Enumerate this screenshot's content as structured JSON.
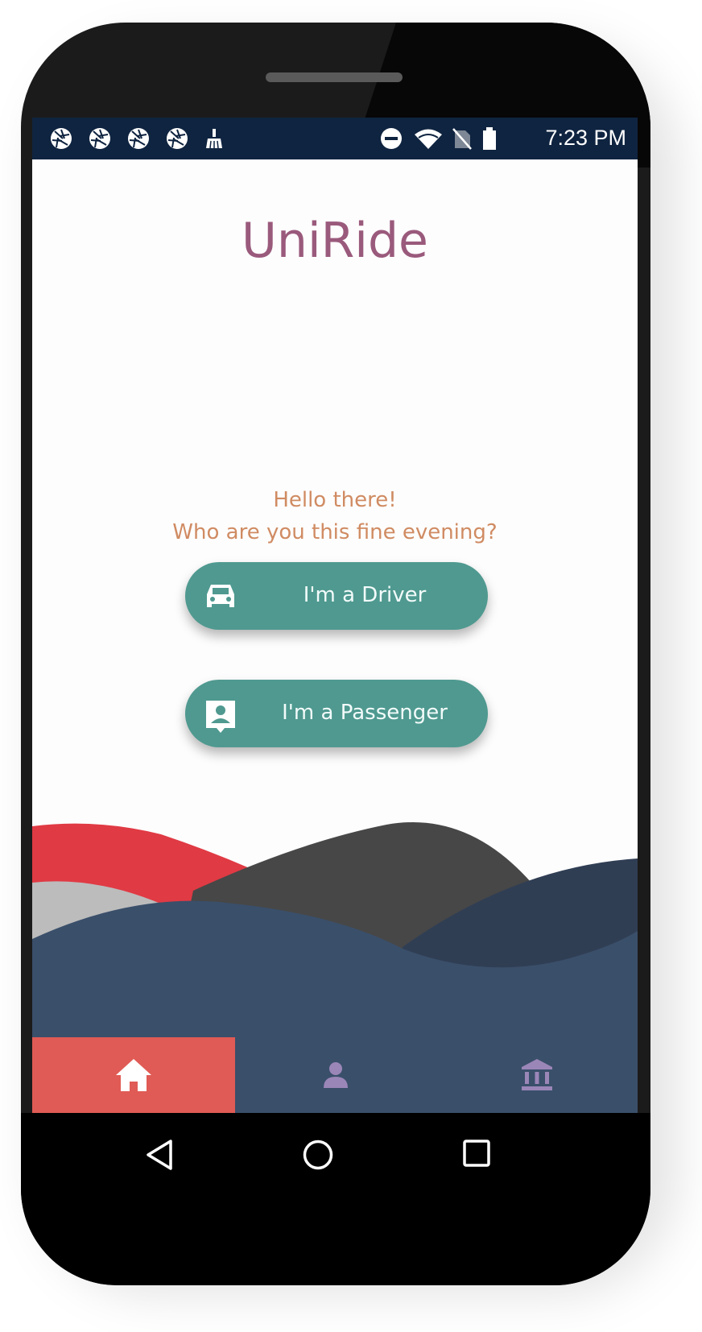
{
  "status_bar": {
    "time": "7:23 PM",
    "left_icons": [
      "aperture-icon",
      "aperture-icon",
      "aperture-icon",
      "aperture-icon",
      "broom-icon"
    ],
    "right_icons": [
      "do-not-disturb-icon",
      "wifi-icon",
      "no-sim-icon",
      "battery-icon"
    ]
  },
  "app": {
    "title": "UniRide",
    "greeting_line1": "Hello there!",
    "greeting_line2": "Who are you this fine evening?"
  },
  "buttons": {
    "driver": {
      "label": "I'm a Driver",
      "icon": "car-icon"
    },
    "passenger": {
      "label": "I'm a Passenger",
      "icon": "contact-icon"
    }
  },
  "tab_bar": {
    "items": [
      {
        "icon": "home-icon",
        "active": true
      },
      {
        "icon": "person-icon",
        "active": false
      },
      {
        "icon": "bank-icon",
        "active": false
      }
    ]
  },
  "colors": {
    "title": "#9a5a7c",
    "greeting": "#d08b62",
    "button": "#4f9990",
    "status_bar": "#0f2440",
    "tab_bar": "#3a4f6a",
    "tab_active": "#e05b55"
  },
  "nav_bar": [
    "back-icon",
    "home-circle-icon",
    "recents-icon"
  ]
}
